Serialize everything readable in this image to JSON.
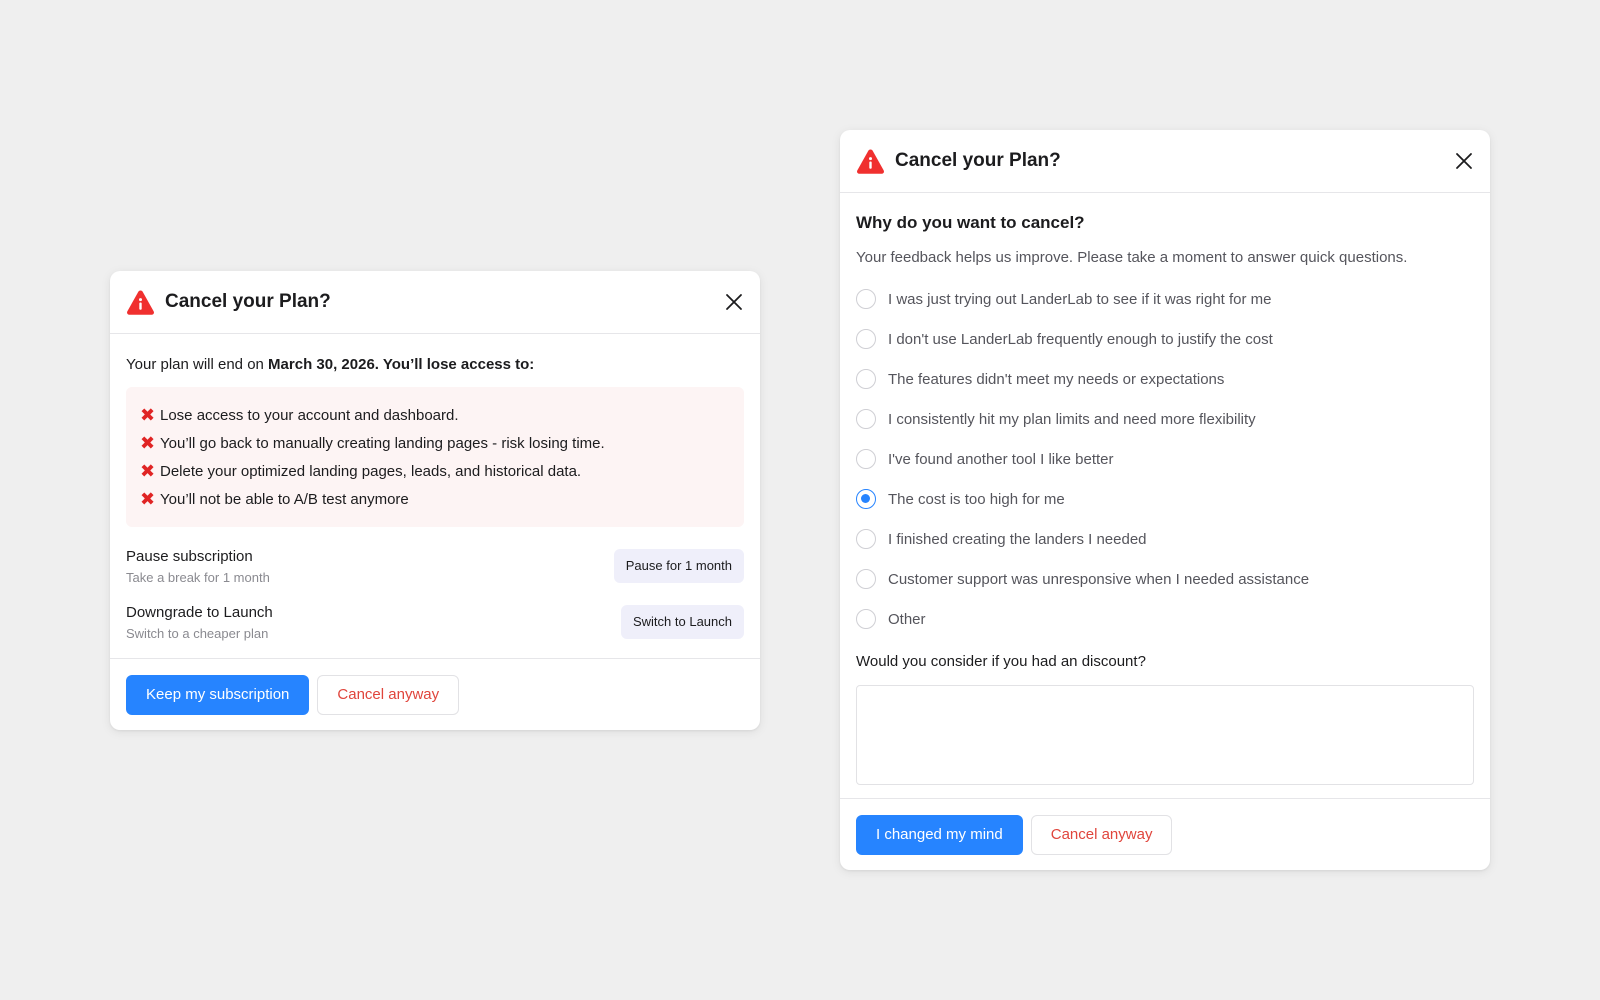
{
  "colors": {
    "background": "#efefef",
    "accent": "#2684ff",
    "danger": "#e0453c",
    "warning_icon": "#f0302f",
    "loss_box_bg": "#fdf4f4"
  },
  "left_modal": {
    "title": "Cancel your Plan?",
    "title_icon": "warning-icon",
    "close_icon": "close-icon",
    "end_prefix": "Your plan will end on ",
    "end_date_text": "March 30, 2026. You’ll lose access to:",
    "losses": [
      "Lose access to your account and dashboard.",
      "You’ll go back to manually creating landing pages - risk losing time.",
      "Delete your optimized landing pages, leads, and historical data.",
      "You’ll not be able to A/B test anymore"
    ],
    "loss_icon": "x-mark-icon",
    "options": [
      {
        "title": "Pause subscription",
        "subtitle": "Take a break for 1 month",
        "button": "Pause for 1 month"
      },
      {
        "title": "Downgrade to Launch",
        "subtitle": "Switch to a cheaper plan",
        "button": "Switch to Launch"
      }
    ],
    "footer": {
      "primary": "Keep my subscription",
      "secondary": "Cancel anyway"
    }
  },
  "right_modal": {
    "title": "Cancel your Plan?",
    "title_icon": "warning-icon",
    "close_icon": "close-icon",
    "question": "Why do you want to cancel?",
    "subtitle": "Your feedback helps us improve. Please take a moment to answer quick questions.",
    "reasons": [
      "I was just trying out LanderLab to see if it was right for me",
      "I don't use LanderLab frequently enough to justify the cost",
      "The features didn't meet my needs or expectations",
      "I consistently hit my plan limits and need more flexibility",
      "I've found another tool I like better",
      "The cost is too high for me",
      "I finished creating the landers I needed",
      "Customer support was unresponsive when I needed assistance",
      "Other"
    ],
    "selected_reason_index": 5,
    "discount_label": "Would you consider if you had an discount?",
    "discount_value": "",
    "footer": {
      "primary": "I changed my mind",
      "secondary": "Cancel anyway"
    }
  }
}
